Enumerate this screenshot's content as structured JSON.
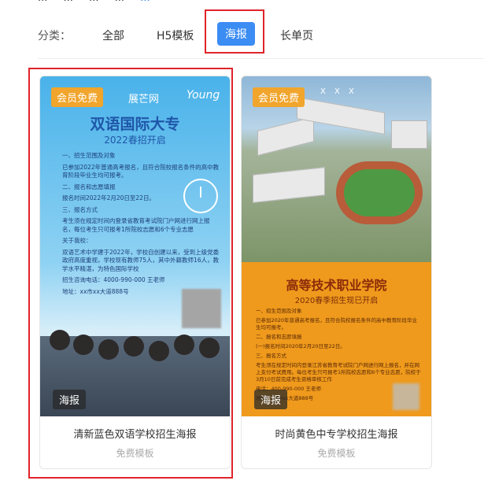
{
  "top_strip": {
    "items": [
      "...",
      "...",
      "...",
      "..."
    ],
    "active": "..."
  },
  "filter": {
    "label": "分类：",
    "items": [
      "全部",
      "H5模板",
      "海报",
      "长单页"
    ],
    "active_index": 2
  },
  "cards": [
    {
      "title": "清新蓝色双语学校招生海报",
      "subtitle": "免费模板",
      "badge_free": "会员免费",
      "badge_type": "海报",
      "poster": {
        "brand": "展芒网",
        "young": "Young",
        "heading": "双语国际大专",
        "subheading": "2022春招开启",
        "lines": [
          "一、招生范围及对象",
          "已参加2022年普通高考报名，且符合院校报名条件的高中教育阶段毕业生均可报考。",
          "二、报名和志愿填报",
          "报名时间2022年2月20日至22日。",
          "三、报名方式",
          "考生须在规定时间内登录省教育考试院门户网进行网上报名，每位考生只可报考1所院校志愿和6个专业志愿",
          "关于我校：",
          "双语艺术中学建于2022年，学校自创建以来，受到上级党委政府高度重视，学校现有教师75人，其中外籍教师16人，教学水平精湛，为特色国际学校",
          "招生咨询电话：4000-990-000 王老师",
          "地址：xx市xx大道888号"
        ]
      }
    },
    {
      "title": "时尚黄色中专学校招生海报",
      "subtitle": "免费模板",
      "badge_free": "会员免费",
      "badge_type": "海报",
      "poster": {
        "mark": "X X X",
        "heading": "高等技术职业学院",
        "subheading": "2020春季招生现已开启",
        "lines": [
          "一、招生范围及对象",
          "已参加2020年普通高考报名，且符合院校报名条件的高中教育阶段毕业生均可报考。",
          "二、报名和志愿填报",
          "(一)报名时间2020年2月20日至22日。",
          "三、报名方式",
          "考生须在规定时间内登录江苏省教育考试院门户网进行网上报名，并在网上支付考试费用。每位考生只可报考1所院校志愿和6个专业志愿，院校于3月10日前完成考生资格审核工作",
          "电话：400-990-000 王老师",
          "地址：xx市xx大道888号"
        ]
      }
    }
  ]
}
